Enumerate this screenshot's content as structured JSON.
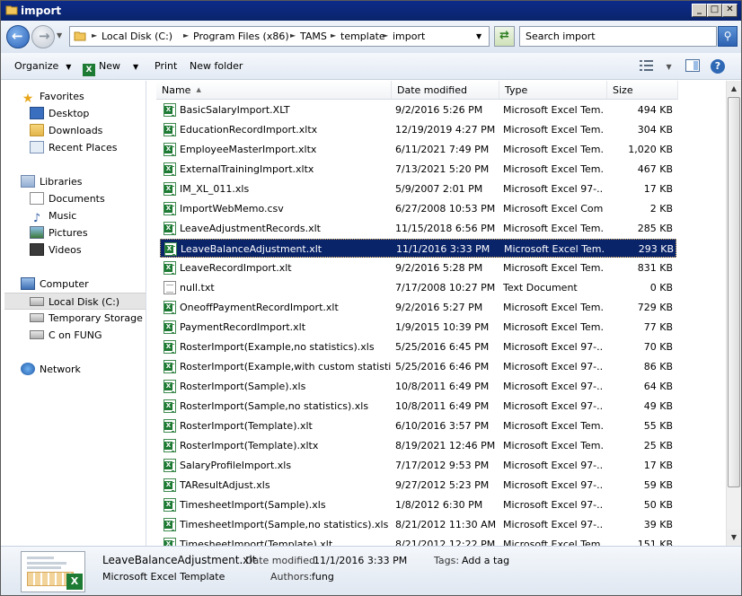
{
  "window": {
    "title": "import"
  },
  "address": {
    "crumbs": [
      "Local Disk (C:)",
      "Program Files (x86)",
      "TAMS",
      "template",
      "import"
    ],
    "search_placeholder": "Search import"
  },
  "toolbar": {
    "organize": "Organize",
    "new": "New",
    "print": "Print",
    "new_folder": "New folder"
  },
  "nav": {
    "favorites": "Favorites",
    "desktop": "Desktop",
    "downloads": "Downloads",
    "recent_places": "Recent Places",
    "libraries": "Libraries",
    "documents": "Documents",
    "music": "Music",
    "pictures": "Pictures",
    "videos": "Videos",
    "computer": "Computer",
    "local_disk": "Local Disk (C:)",
    "temp_storage": "Temporary Storage (D",
    "c_on_fung": "C on FUNG",
    "network": "Network"
  },
  "columns": {
    "name": "Name",
    "date": "Date modified",
    "type": "Type",
    "size": "Size"
  },
  "files": [
    {
      "name": "BasicSalaryImport.XLT",
      "date": "9/2/2016 5:26 PM",
      "type": "Microsoft Excel Tem...",
      "size": "494 KB",
      "icon": "excel-template-icon"
    },
    {
      "name": "EducationRecordImport.xltx",
      "date": "12/19/2019 4:27 PM",
      "type": "Microsoft Excel Tem...",
      "size": "304 KB",
      "icon": "excel-template-icon"
    },
    {
      "name": "EmployeeMasterImport.xltx",
      "date": "6/11/2021 7:49 PM",
      "type": "Microsoft Excel Tem...",
      "size": "1,020 KB",
      "icon": "excel-template-icon"
    },
    {
      "name": "ExternalTrainingImport.xltx",
      "date": "7/13/2021 5:20 PM",
      "type": "Microsoft Excel Tem...",
      "size": "467 KB",
      "icon": "excel-template-icon"
    },
    {
      "name": "IM_XL_011.xls",
      "date": "5/9/2007 2:01 PM",
      "type": "Microsoft Excel 97-...",
      "size": "17 KB",
      "icon": "excel-97-icon"
    },
    {
      "name": "ImportWebMemo.csv",
      "date": "6/27/2008 10:53 PM",
      "type": "Microsoft Excel Com...",
      "size": "2 KB",
      "icon": "excel-csv-icon"
    },
    {
      "name": "LeaveAdjustmentRecords.xlt",
      "date": "11/15/2018 6:56 PM",
      "type": "Microsoft Excel Tem...",
      "size": "285 KB",
      "icon": "excel-template-icon"
    },
    {
      "name": "LeaveBalanceAdjustment.xlt",
      "date": "11/1/2016 3:33 PM",
      "type": "Microsoft Excel Tem...",
      "size": "293 KB",
      "icon": "excel-template-icon",
      "selected": true
    },
    {
      "name": "LeaveRecordImport.xlt",
      "date": "9/2/2016 5:28 PM",
      "type": "Microsoft Excel Tem...",
      "size": "831 KB",
      "icon": "excel-template-icon"
    },
    {
      "name": "null.txt",
      "date": "7/17/2008 10:27 PM",
      "type": "Text Document",
      "size": "0 KB",
      "icon": "text-file-icon"
    },
    {
      "name": "OneoffPaymentRecordImport.xlt",
      "date": "9/2/2016 5:27 PM",
      "type": "Microsoft Excel Tem...",
      "size": "729 KB",
      "icon": "excel-template-icon"
    },
    {
      "name": "PaymentRecordImport.xlt",
      "date": "1/9/2015 10:39 PM",
      "type": "Microsoft Excel Tem...",
      "size": "77 KB",
      "icon": "excel-template-icon"
    },
    {
      "name": "RosterImport(Example,no statistics).xls",
      "date": "5/25/2016 6:45 PM",
      "type": "Microsoft Excel 97-...",
      "size": "70 KB",
      "icon": "excel-97-icon"
    },
    {
      "name": "RosterImport(Example,with custom statistics...",
      "date": "5/25/2016 6:46 PM",
      "type": "Microsoft Excel 97-...",
      "size": "86 KB",
      "icon": "excel-97-icon"
    },
    {
      "name": "RosterImport(Sample).xls",
      "date": "10/8/2011 6:49 PM",
      "type": "Microsoft Excel 97-...",
      "size": "64 KB",
      "icon": "excel-97-icon"
    },
    {
      "name": "RosterImport(Sample,no statistics).xls",
      "date": "10/8/2011 6:49 PM",
      "type": "Microsoft Excel 97-...",
      "size": "49 KB",
      "icon": "excel-97-icon"
    },
    {
      "name": "RosterImport(Template).xlt",
      "date": "6/10/2016 3:57 PM",
      "type": "Microsoft Excel Tem...",
      "size": "55 KB",
      "icon": "excel-template-icon"
    },
    {
      "name": "RosterImport(Template).xltx",
      "date": "8/19/2021 12:46 PM",
      "type": "Microsoft Excel Tem...",
      "size": "25 KB",
      "icon": "excel-template-icon"
    },
    {
      "name": "SalaryProfileImport.xls",
      "date": "7/17/2012 9:53 PM",
      "type": "Microsoft Excel 97-...",
      "size": "17 KB",
      "icon": "excel-97-icon"
    },
    {
      "name": "TAResultAdjust.xls",
      "date": "9/27/2012 5:23 PM",
      "type": "Microsoft Excel 97-...",
      "size": "59 KB",
      "icon": "excel-97-icon"
    },
    {
      "name": "TimesheetImport(Sample).xls",
      "date": "1/8/2012 6:30 PM",
      "type": "Microsoft Excel 97-...",
      "size": "50 KB",
      "icon": "excel-97-icon"
    },
    {
      "name": "TimesheetImport(Sample,no statistics).xls",
      "date": "8/21/2012 11:30 AM",
      "type": "Microsoft Excel 97-...",
      "size": "39 KB",
      "icon": "excel-97-icon"
    },
    {
      "name": "TimesheetImport(Template).xlt",
      "date": "8/21/2012 12:22 PM",
      "type": "Microsoft Excel Tem...",
      "size": "151 KB",
      "icon": "excel-template-icon"
    }
  ],
  "details": {
    "filename": "LeaveBalanceAdjustment.xlt",
    "filetype": "Microsoft Excel Template",
    "date_label": "Date modified:",
    "date_value": "11/1/2016 3:33 PM",
    "authors_label": "Authors:",
    "authors_value": "fung",
    "tags_label": "Tags:",
    "tags_value": "Add a tag"
  },
  "colors": {
    "selection": "#0a246a",
    "titlebar": "#0a246a"
  }
}
